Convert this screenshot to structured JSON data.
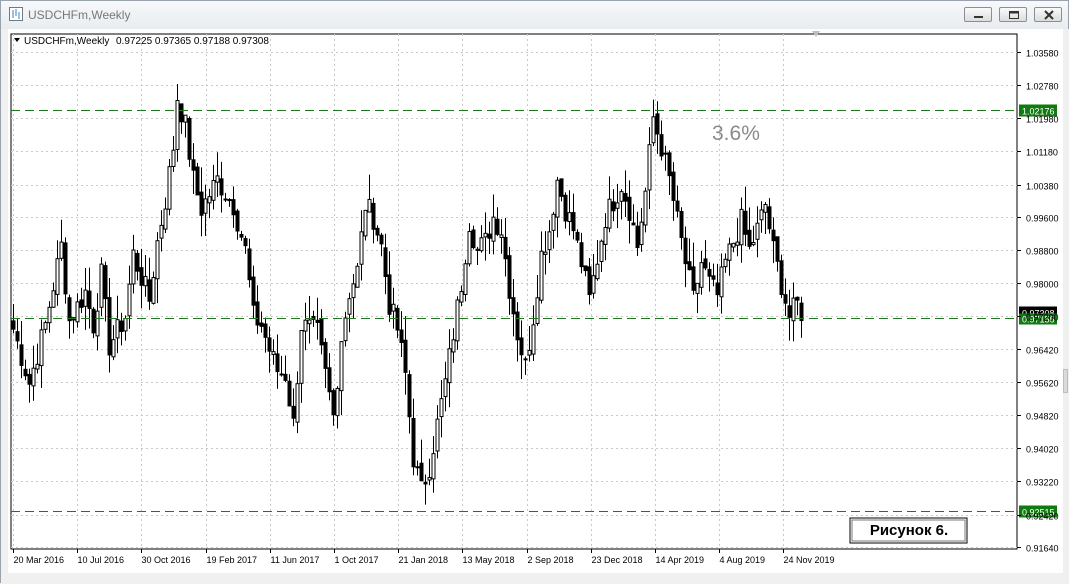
{
  "window": {
    "title": "USDCHFm,Weekly"
  },
  "chart_header": {
    "symbol_info": "USDCHFm,Weekly",
    "ohlc": "0.97225 0.97365 0.97188 0.97308"
  },
  "annotations": {
    "percent_label": "3.6%",
    "figure_caption": "Рисунок 6."
  },
  "colors": {
    "candle": "#000000",
    "level_line": "#1a7a1a",
    "level_badge_bg": "#0f7a0f",
    "grid": "#c9c9c9",
    "percent_text": "#8a8a8a"
  },
  "chart_data": {
    "type": "candlestick",
    "timeframe": "Weekly",
    "symbol": "USDCHFm",
    "ylim": [
      0.9164,
      1.0358
    ],
    "price_axis_ticks": [
      "1.03580",
      "1.02780",
      "1.01980",
      "1.01180",
      "1.00380",
      "0.99600",
      "0.98800",
      "0.98000",
      "0.97200",
      "0.96420",
      "0.95620",
      "0.94820",
      "0.94020",
      "0.93220",
      "0.92420",
      "0.91640"
    ],
    "date_axis_ticks": [
      "20 Mar 2016",
      "10 Jul 2016",
      "30 Oct 2016",
      "19 Feb 2017",
      "11 Jun 2017",
      "1 Oct 2017",
      "21 Jan 2018",
      "13 May 2018",
      "2 Sep 2018",
      "23 Dec 2018",
      "14 Apr 2019",
      "4 Aug 2019",
      "24 Nov 2019"
    ],
    "horizontal_levels": [
      {
        "label": "1.02176",
        "value": 1.02176
      },
      {
        "label": "0.97156",
        "value": 0.97156
      },
      {
        "label": "0.92515",
        "value": 0.92515
      }
    ],
    "current_price_label": "0.97308",
    "grid": true,
    "series_anchor_closes": [
      {
        "week": 0,
        "close": 0.969
      },
      {
        "week": 4,
        "close": 0.956
      },
      {
        "week": 8,
        "close": 0.97
      },
      {
        "week": 12,
        "close": 0.989
      },
      {
        "week": 14,
        "close": 0.971
      },
      {
        "week": 18,
        "close": 0.978
      },
      {
        "week": 20,
        "close": 0.97
      },
      {
        "week": 22,
        "close": 0.982
      },
      {
        "week": 24,
        "close": 0.965
      },
      {
        "week": 28,
        "close": 0.972
      },
      {
        "week": 30,
        "close": 0.987
      },
      {
        "week": 34,
        "close": 0.976
      },
      {
        "week": 36,
        "close": 0.99
      },
      {
        "week": 38,
        "close": 1.0
      },
      {
        "week": 40,
        "close": 1.013
      },
      {
        "week": 41,
        "close": 1.025
      },
      {
        "week": 43,
        "close": 1.018
      },
      {
        "week": 45,
        "close": 1.005
      },
      {
        "week": 47,
        "close": 0.998
      },
      {
        "week": 51,
        "close": 1.005
      },
      {
        "week": 55,
        "close": 0.999
      },
      {
        "week": 58,
        "close": 0.988
      },
      {
        "week": 60,
        "close": 0.972
      },
      {
        "week": 62,
        "close": 0.97
      },
      {
        "week": 64,
        "close": 0.964
      },
      {
        "week": 66,
        "close": 0.959
      },
      {
        "week": 68,
        "close": 0.958
      },
      {
        "week": 70,
        "close": 0.946
      },
      {
        "week": 72,
        "close": 0.97
      },
      {
        "week": 76,
        "close": 0.968
      },
      {
        "week": 78,
        "close": 0.958
      },
      {
        "week": 80,
        "close": 0.948
      },
      {
        "week": 82,
        "close": 0.967
      },
      {
        "week": 84,
        "close": 0.978
      },
      {
        "week": 86,
        "close": 0.983
      },
      {
        "week": 88,
        "close": 0.999
      },
      {
        "week": 90,
        "close": 0.996
      },
      {
        "week": 92,
        "close": 0.989
      },
      {
        "week": 94,
        "close": 0.975
      },
      {
        "week": 96,
        "close": 0.969
      },
      {
        "week": 98,
        "close": 0.958
      },
      {
        "week": 100,
        "close": 0.938
      },
      {
        "week": 102,
        "close": 0.93
      },
      {
        "week": 104,
        "close": 0.936
      },
      {
        "week": 106,
        "close": 0.946
      },
      {
        "week": 108,
        "close": 0.956
      },
      {
        "week": 110,
        "close": 0.968
      },
      {
        "week": 112,
        "close": 0.98
      },
      {
        "week": 114,
        "close": 0.995
      },
      {
        "week": 116,
        "close": 0.988
      },
      {
        "week": 118,
        "close": 0.99
      },
      {
        "week": 120,
        "close": 0.996
      },
      {
        "week": 122,
        "close": 0.993
      },
      {
        "week": 124,
        "close": 0.979
      },
      {
        "week": 126,
        "close": 0.968
      },
      {
        "week": 128,
        "close": 0.96
      },
      {
        "week": 130,
        "close": 0.972
      },
      {
        "week": 132,
        "close": 0.987
      },
      {
        "week": 134,
        "close": 0.993
      },
      {
        "week": 136,
        "close": 1.005
      },
      {
        "week": 138,
        "close": 0.998
      },
      {
        "week": 140,
        "close": 0.993
      },
      {
        "week": 142,
        "close": 0.985
      },
      {
        "week": 144,
        "close": 0.976
      },
      {
        "week": 146,
        "close": 0.986
      },
      {
        "week": 148,
        "close": 0.996
      },
      {
        "week": 150,
        "close": 1.0
      },
      {
        "week": 152,
        "close": 1.004
      },
      {
        "week": 154,
        "close": 0.998
      },
      {
        "week": 156,
        "close": 0.989
      },
      {
        "week": 158,
        "close": 1.002
      },
      {
        "week": 160,
        "close": 1.02
      },
      {
        "week": 162,
        "close": 1.013
      },
      {
        "week": 164,
        "close": 1.005
      },
      {
        "week": 166,
        "close": 0.995
      },
      {
        "week": 168,
        "close": 0.985
      },
      {
        "week": 170,
        "close": 0.976
      },
      {
        "week": 172,
        "close": 0.985
      },
      {
        "week": 174,
        "close": 0.98
      },
      {
        "week": 176,
        "close": 0.977
      },
      {
        "week": 178,
        "close": 0.985
      },
      {
        "week": 180,
        "close": 0.99
      },
      {
        "week": 182,
        "close": 0.995
      },
      {
        "week": 184,
        "close": 0.988
      },
      {
        "week": 186,
        "close": 0.993
      },
      {
        "week": 188,
        "close": 0.999
      },
      {
        "week": 190,
        "close": 0.988
      },
      {
        "week": 192,
        "close": 0.98
      },
      {
        "week": 194,
        "close": 0.972
      },
      {
        "week": 196,
        "close": 0.975
      },
      {
        "week": 197,
        "close": 0.9731
      }
    ]
  }
}
